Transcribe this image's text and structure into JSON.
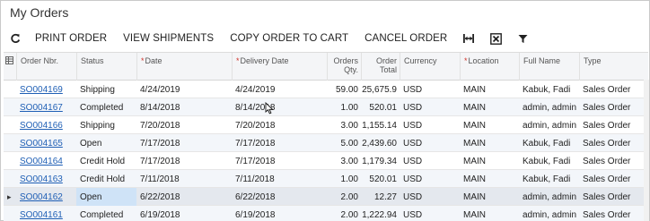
{
  "page": {
    "title": "My Orders"
  },
  "toolbar": {
    "print_order": "PRINT ORDER",
    "view_shipments": "VIEW SHIPMENTS",
    "copy_order": "COPY ORDER TO CART",
    "cancel_order": "CANCEL ORDER"
  },
  "columns": {
    "order_nbr": "Order Nbr.",
    "status": "Status",
    "date": "Date",
    "delivery_date": "Delivery Date",
    "order_qty_1": "Orders",
    "order_qty_2": "Qty.",
    "order_total_1": "Order",
    "order_total_2": "Total",
    "currency": "Currency",
    "location": "Location",
    "full_name": "Full Name",
    "type": "Type",
    "required_mark": "*"
  },
  "rows": [
    {
      "order_nbr": "SO004169",
      "status": "Shipping",
      "date": "4/24/2019",
      "delivery_date": "4/24/2019",
      "qty": "59.00",
      "total": "25,675.9",
      "currency": "USD",
      "location": "MAIN",
      "full_name": "Kabuk, Fadi",
      "type": "Sales Order"
    },
    {
      "order_nbr": "SO004167",
      "status": "Completed",
      "date": "8/14/2018",
      "delivery_date": "8/14/2018",
      "qty": "1.00",
      "total": "520.01",
      "currency": "USD",
      "location": "MAIN",
      "full_name": "admin, admin",
      "type": "Sales Order"
    },
    {
      "order_nbr": "SO004166",
      "status": "Shipping",
      "date": "7/20/2018",
      "delivery_date": "7/20/2018",
      "qty": "3.00",
      "total": "1,155.14",
      "currency": "USD",
      "location": "MAIN",
      "full_name": "admin, admin",
      "type": "Sales Order"
    },
    {
      "order_nbr": "SO004165",
      "status": "Open",
      "date": "7/17/2018",
      "delivery_date": "7/17/2018",
      "qty": "5.00",
      "total": "2,439.60",
      "currency": "USD",
      "location": "MAIN",
      "full_name": "Kabuk, Fadi",
      "type": "Sales Order"
    },
    {
      "order_nbr": "SO004164",
      "status": "Credit Hold",
      "date": "7/17/2018",
      "delivery_date": "7/17/2018",
      "qty": "3.00",
      "total": "1,179.34",
      "currency": "USD",
      "location": "MAIN",
      "full_name": "Kabuk, Fadi",
      "type": "Sales Order"
    },
    {
      "order_nbr": "SO004163",
      "status": "Credit Hold",
      "date": "7/11/2018",
      "delivery_date": "7/11/2018",
      "qty": "1.00",
      "total": "520.01",
      "currency": "USD",
      "location": "MAIN",
      "full_name": "Kabuk, Fadi",
      "type": "Sales Order"
    },
    {
      "order_nbr": "SO004162",
      "status": "Open",
      "date": "6/22/2018",
      "delivery_date": "6/22/2018",
      "qty": "2.00",
      "total": "12.27",
      "currency": "USD",
      "location": "MAIN",
      "full_name": "admin, admin",
      "type": "Sales Order"
    },
    {
      "order_nbr": "SO004161",
      "status": "Completed",
      "date": "6/19/2018",
      "delivery_date": "6/19/2018",
      "qty": "2.00",
      "total": "1,222.94",
      "currency": "USD",
      "location": "MAIN",
      "full_name": "admin, admin",
      "type": "Sales Order"
    }
  ],
  "icons": {
    "refresh": "refresh-icon",
    "fit_columns": "fit-columns-icon",
    "export_excel": "export-excel-icon",
    "filter": "filter-icon",
    "row_indicator": "row-selected-arrow-icon",
    "mouse_cursor": "mouse-cursor-icon"
  },
  "colors": {
    "link": "#1f5fb5",
    "required": "#d0342c",
    "header_bg": "#f4f5f7",
    "alt_row_bg": "#f3f6fa",
    "selected_row_bg": "#e4e8ee",
    "status_highlight": "#cfe3f7"
  }
}
